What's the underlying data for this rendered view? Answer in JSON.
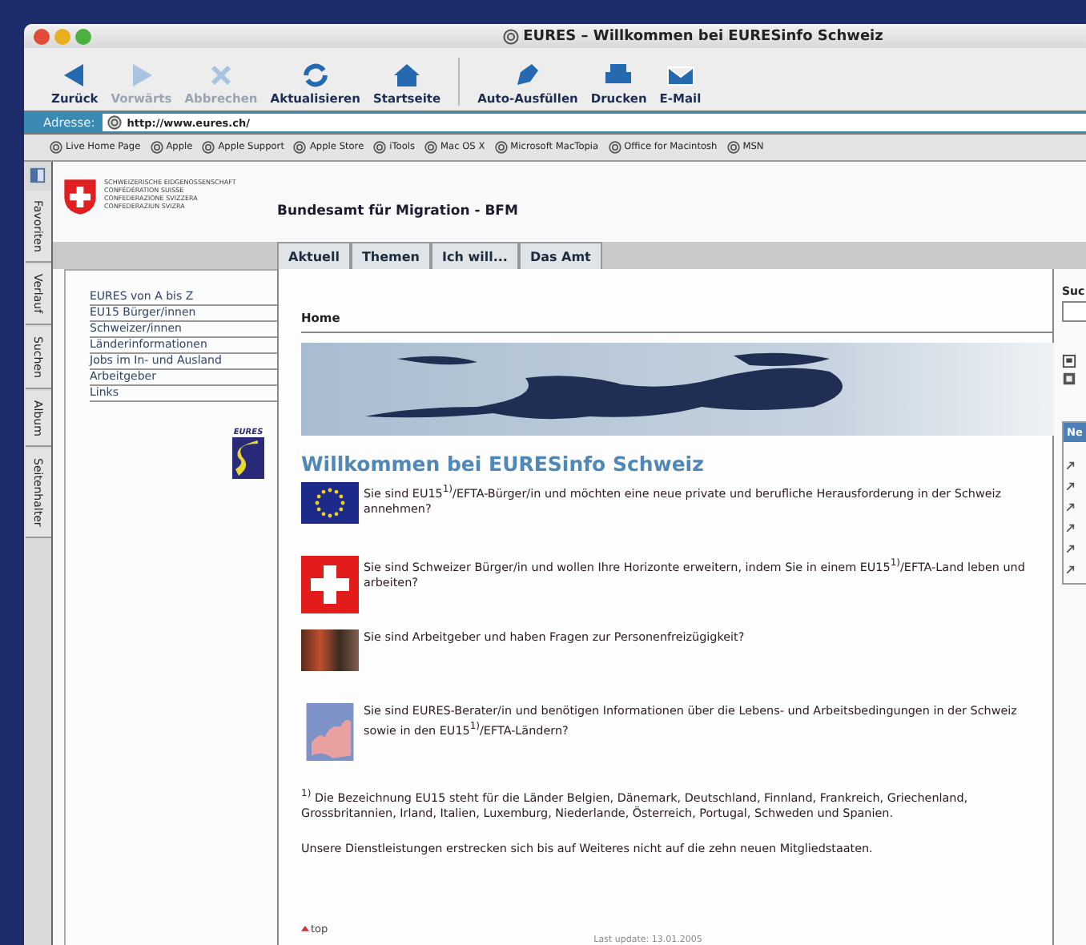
{
  "window": {
    "title": "EURES – Willkommen bei EURESinfo Schweiz"
  },
  "toolbar": [
    {
      "label": "Zurück",
      "kind": "back",
      "disabled": false,
      "separator_before": false
    },
    {
      "label": "Vorwärts",
      "kind": "forward",
      "disabled": true,
      "separator_before": false
    },
    {
      "label": "Abbrechen",
      "kind": "stop",
      "disabled": true,
      "separator_before": false
    },
    {
      "label": "Aktualisieren",
      "kind": "reload",
      "disabled": false,
      "separator_before": false
    },
    {
      "label": "Startseite",
      "kind": "home",
      "disabled": false,
      "separator_before": false
    },
    {
      "label": "Auto-Ausfüllen",
      "kind": "autofill",
      "disabled": false,
      "separator_before": true
    },
    {
      "label": "Drucken",
      "kind": "print",
      "disabled": false,
      "separator_before": false
    },
    {
      "label": "E-Mail",
      "kind": "mail",
      "disabled": false,
      "separator_before": false
    }
  ],
  "address": {
    "label": "Adresse:",
    "value": "http://www.eures.ch/"
  },
  "favorites": [
    "Live Home Page",
    "Apple",
    "Apple Support",
    "Apple Store",
    "iTools",
    "Mac OS X",
    "Microsoft MacTopia",
    "Office for Macintosh",
    "MSN"
  ],
  "side_tabs": [
    "Favoriten",
    "Verlauf",
    "Suchen",
    "Album",
    "Seitenhalter"
  ],
  "page": {
    "emblem_lines": [
      "SCHWEIZERISCHE EIDGENOSSENSCHAFT",
      "CONFÉDÉRATION SUISSE",
      "CONFEDERAZIONE SVIZZERA",
      "CONFEDERAZIUN SVIZRA"
    ],
    "agency": "Bundesamt für Migration - BFM",
    "tabs": [
      {
        "label": "Aktuell",
        "selected": false
      },
      {
        "label": "Themen",
        "selected": false
      },
      {
        "label": "Ich will...",
        "selected": false
      },
      {
        "label": "Das Amt",
        "selected": false
      }
    ],
    "nav": [
      "EURES von A bis Z",
      "EU15 Bürger/innen",
      "Schweizer/innen",
      "Länderinformationen",
      "Jobs im In- und Ausland",
      "Arbeitgeber",
      "Links"
    ],
    "logo_text": "EURES",
    "breadcrumb": "Home",
    "heading": "Willkommen bei EURESinfo Schweiz",
    "rows": [
      {
        "kind": "eu_flag",
        "text": "Sie sind EU15$^{1)}$/EFTA-Bürger/in und möchten eine neue private und berufliche Herausforderung in der Schweiz annehmen?"
      },
      {
        "kind": "swiss_flag",
        "text": "Sie sind Schweizer Bürger/in und wollen Ihre Horizonte erweitern, indem Sie in einem EU15$^{1)}$/EFTA-Land leben und arbeiten?"
      },
      {
        "kind": "photo",
        "text": "Sie sind Arbeitgeber und haben Fragen zur Personenfreizügigkeit?"
      },
      {
        "kind": "map",
        "text": "Sie sind EURES-Berater/in und benötigen Informationen über die Lebens- und Arbeitsbedingungen in der Schweiz sowie in den EU15$^{1)}$/EFTA-Ländern?"
      }
    ],
    "footnote": "$^{1)}$ Die Bezeichnung EU15 steht für die Länder Belgien, Dänemark, Deutschland, Finnland, Frankreich, Griechenland, Grossbritannien, Irland, Italien, Luxemburg, Niederlande, Österreich, Portugal, Schweden und Spanien.",
    "note": "Unsere Dienstleistungen erstrecken sich bis auf Weiteres nicht auf die zehn neuen Mitgliedstaaten.",
    "top_link": "top",
    "last_update": "Last update: 13.01.2005",
    "search_label": "Suc",
    "news_title": "Ne"
  }
}
